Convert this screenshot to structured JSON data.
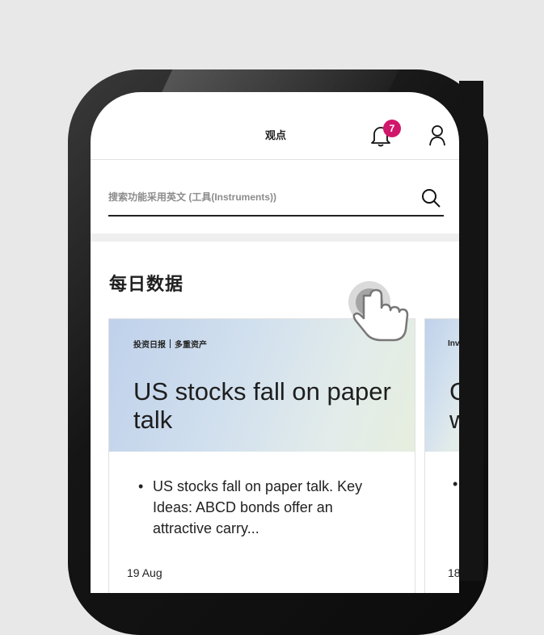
{
  "header": {
    "title": "观点",
    "notification_count": "7"
  },
  "search": {
    "placeholder": "搜索功能采用英文 (工具(Instruments))"
  },
  "section": {
    "title": "每日数据"
  },
  "cards": [
    {
      "tag_primary": "投资日报",
      "tag_secondary": "多重资产",
      "headline": "US stocks fall on paper talk",
      "bullet": "US stocks fall on paper talk. Key Ideas: ABCD bonds offer an attractive carry...",
      "date": "19 Aug"
    },
    {
      "tag_primary": "Inv",
      "headline": "G\nw",
      "bullet": "•",
      "date": "18"
    }
  ],
  "colors": {
    "badge": "#d1176b",
    "background": "#e8e8e8",
    "frame": "#1b1b1b"
  }
}
